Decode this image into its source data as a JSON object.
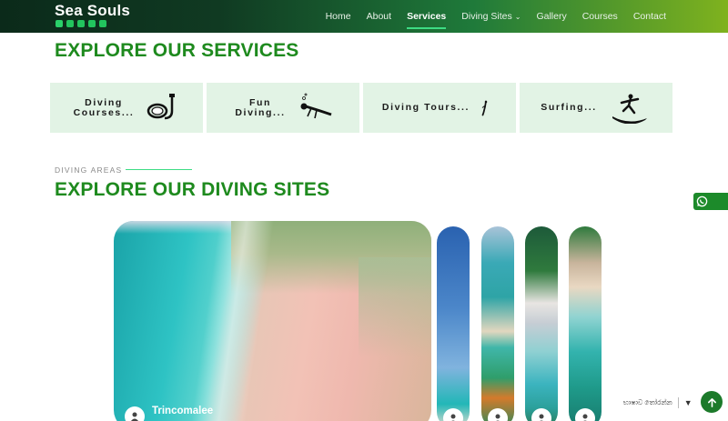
{
  "header": {
    "brand": "Sea Souls",
    "socials": [
      "youtube-icon",
      "facebook-icon",
      "instagram-icon",
      "whatsapp-icon",
      "tiktok-icon"
    ],
    "nav": [
      {
        "label": "Home"
      },
      {
        "label": "About"
      },
      {
        "label": "Services",
        "active": true
      },
      {
        "label": "Diving Sites",
        "has_dropdown": true
      },
      {
        "label": "Gallery"
      },
      {
        "label": "Courses"
      },
      {
        "label": "Contact"
      }
    ]
  },
  "services": {
    "title": "EXPLORE OUR SERVICES",
    "cards": [
      {
        "label": "Diving Courses...",
        "icon": "snorkel-mask-icon"
      },
      {
        "label": "Fun Diving...",
        "icon": "scuba-diver-icon"
      },
      {
        "label": "Diving Tours...",
        "icon": "diver-icon"
      },
      {
        "label": "Surfing...",
        "icon": "surfer-icon"
      }
    ]
  },
  "diving_sites": {
    "eyebrow": "DIVING AREAS",
    "title": "EXPLORE OUR DIVING SITES",
    "featured": "Trincomalee"
  },
  "footer_widgets": {
    "language_label": "භාෂාව තෝරන්න",
    "accent": "#1c7a2a"
  },
  "colors": {
    "heading_green": "#1e8a1e",
    "card_bg": "#e2f3e5",
    "nav_active_underline": "#3ddc84"
  }
}
